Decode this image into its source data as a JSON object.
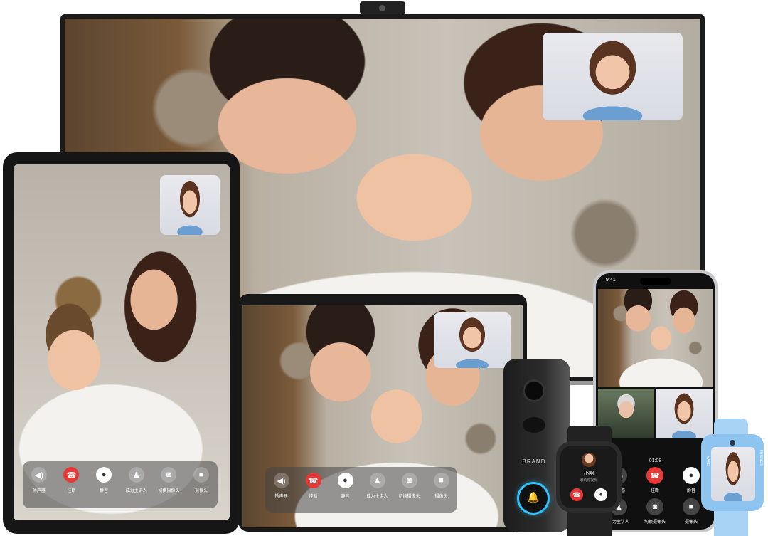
{
  "tv_controls": [],
  "ipad_controls": [
    {
      "label": "扬声器",
      "icon": "speaker-icon",
      "glyph": "◀)",
      "style": ""
    },
    {
      "label": "挂断",
      "icon": "hang-up-icon",
      "glyph": "☎",
      "style": "red"
    },
    {
      "label": "静音",
      "icon": "mic-icon",
      "glyph": "●",
      "style": "white"
    },
    {
      "label": "成为主讲人",
      "icon": "presenter-icon",
      "glyph": "♟",
      "style": ""
    },
    {
      "label": "切换摄像头",
      "icon": "camera-switch-icon",
      "glyph": "◙",
      "style": ""
    },
    {
      "label": "摄像头",
      "icon": "video-camera-icon",
      "glyph": "■",
      "style": ""
    }
  ],
  "tablet_controls": [
    {
      "label": "扬声器",
      "icon": "speaker-icon",
      "glyph": "◀)",
      "style": ""
    },
    {
      "label": "挂断",
      "icon": "hang-up-icon",
      "glyph": "☎",
      "style": "red"
    },
    {
      "label": "静音",
      "icon": "mic-icon",
      "glyph": "●",
      "style": "white"
    },
    {
      "label": "成为主讲人",
      "icon": "presenter-icon",
      "glyph": "♟",
      "style": ""
    },
    {
      "label": "切换摄像头",
      "icon": "camera-switch-icon",
      "glyph": "◙",
      "style": ""
    },
    {
      "label": "摄像头",
      "icon": "video-camera-icon",
      "glyph": "■",
      "style": ""
    }
  ],
  "phone": {
    "time": "9:41",
    "call_timer": "01:08",
    "row1": [
      {
        "label": "扬声器",
        "icon": "speaker-icon",
        "glyph": "◀)",
        "style": ""
      },
      {
        "label": "挂断",
        "icon": "hang-up-icon",
        "glyph": "☎",
        "style": "red"
      },
      {
        "label": "静音",
        "icon": "mic-icon",
        "glyph": "●",
        "style": "white"
      }
    ],
    "row2": [
      {
        "label": "成为主讲人",
        "icon": "presenter-icon",
        "glyph": "♟",
        "style": ""
      },
      {
        "label": "切换摄像头",
        "icon": "camera-switch-icon",
        "glyph": "◙",
        "style": ""
      },
      {
        "label": "摄像头",
        "icon": "video-camera-icon",
        "glyph": "■",
        "style": ""
      }
    ]
  },
  "doorbell": {
    "brand": "BRAND"
  },
  "watch": {
    "caller_name": "小明",
    "caller_status": "邀请你视频"
  },
  "kids_watch": {
    "left_text": "MAKE",
    "right_text": "FRIENDS"
  }
}
